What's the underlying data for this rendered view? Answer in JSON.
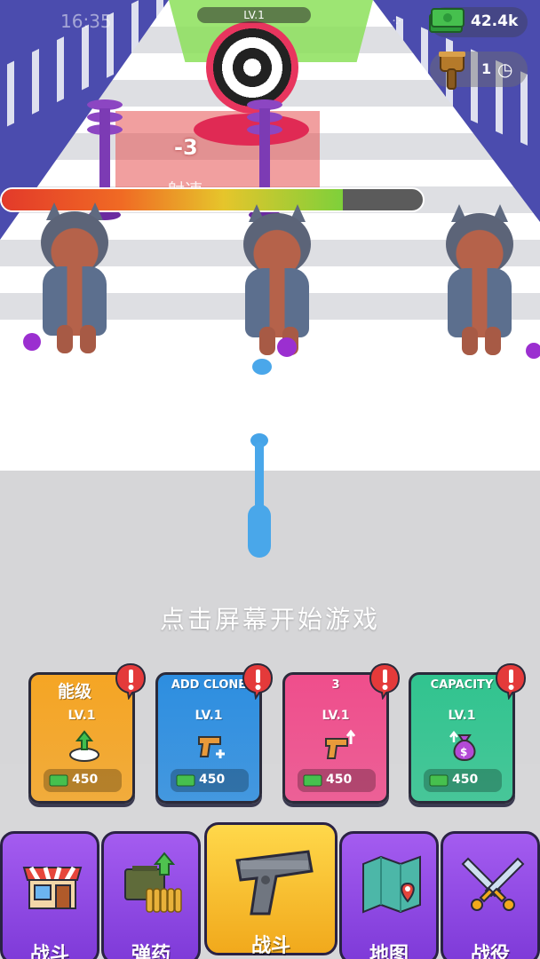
{
  "status": {
    "time": "16:35"
  },
  "hud": {
    "level": "LV.1",
    "money": "42.4k",
    "hammer_count": "1",
    "health_fraction": 0.81
  },
  "scene": {
    "damage_text": "-3",
    "fading_text": "射速"
  },
  "hint": "点击屏幕开始游戏",
  "cards": [
    {
      "title": "能级",
      "level": "LV.1",
      "price": "450",
      "color": "#f5a524",
      "icon": "power-base-icon"
    },
    {
      "title": "ADD CLONE",
      "level": "LV.1",
      "price": "450",
      "color": "#2d8ee0",
      "icon": "gun-clone-icon"
    },
    {
      "title": "3",
      "level": "LV.1",
      "price": "450",
      "color": "#ef4e8c",
      "icon": "gun-upgrade-icon"
    },
    {
      "title": "CAPACITY",
      "level": "LV.1",
      "price": "450",
      "color": "#31c48f",
      "icon": "money-bag-icon"
    }
  ],
  "nav": [
    {
      "label": "战斗",
      "icon": "shop-icon"
    },
    {
      "label": "弹药",
      "icon": "ammo-icon"
    },
    {
      "label": "战斗",
      "icon": "pistol-icon"
    },
    {
      "label": "地图",
      "icon": "map-icon"
    },
    {
      "label": "战役",
      "icon": "crossed-swords-icon"
    }
  ]
}
